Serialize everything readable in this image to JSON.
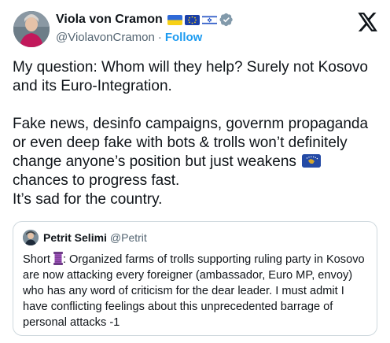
{
  "author": {
    "name": "Viola von Cramon",
    "handle": "@ViolavonCramon",
    "separator": "·",
    "follow_label": "Follow"
  },
  "tweet": {
    "paragraph1": "My question: Whom will they help? Surely not Kosovo and its Euro-Integration.",
    "paragraph2_before_flag": "Fake news, desinfo campaigns, governm propaganda or even deep fake with bots & trolls won’t definitely change anyone’s position but just weakens",
    "paragraph2_after_flag": "chances to progress fast.",
    "paragraph3": "It’s sad for the country."
  },
  "quote": {
    "name": "Petrit Selimi",
    "handle": "@Petrit",
    "text_before_icon": "Short",
    "text_after_icon": ": Organized farms of trolls supporting ruling party in Kosovo are now attacking every foreigner (ambassador, Euro MP, envoy) who has any word of criticism for the dear leader. I must admit I have conflicting feelings about this unprecedented barrage of personal attacks -1"
  },
  "icons": {
    "flags": [
      "ukraine-flag-icon",
      "eu-flag-icon",
      "israel-flag-icon"
    ],
    "verified": "verified-badge-icon",
    "platform": "x-logo-icon",
    "inline_flag": "kosovo-flag-icon",
    "inline_emoji": "thread-spool-icon"
  },
  "colors": {
    "accent": "#1d9bf0",
    "text": "#0f1419",
    "muted": "#536471",
    "border": "#cfd9de"
  }
}
